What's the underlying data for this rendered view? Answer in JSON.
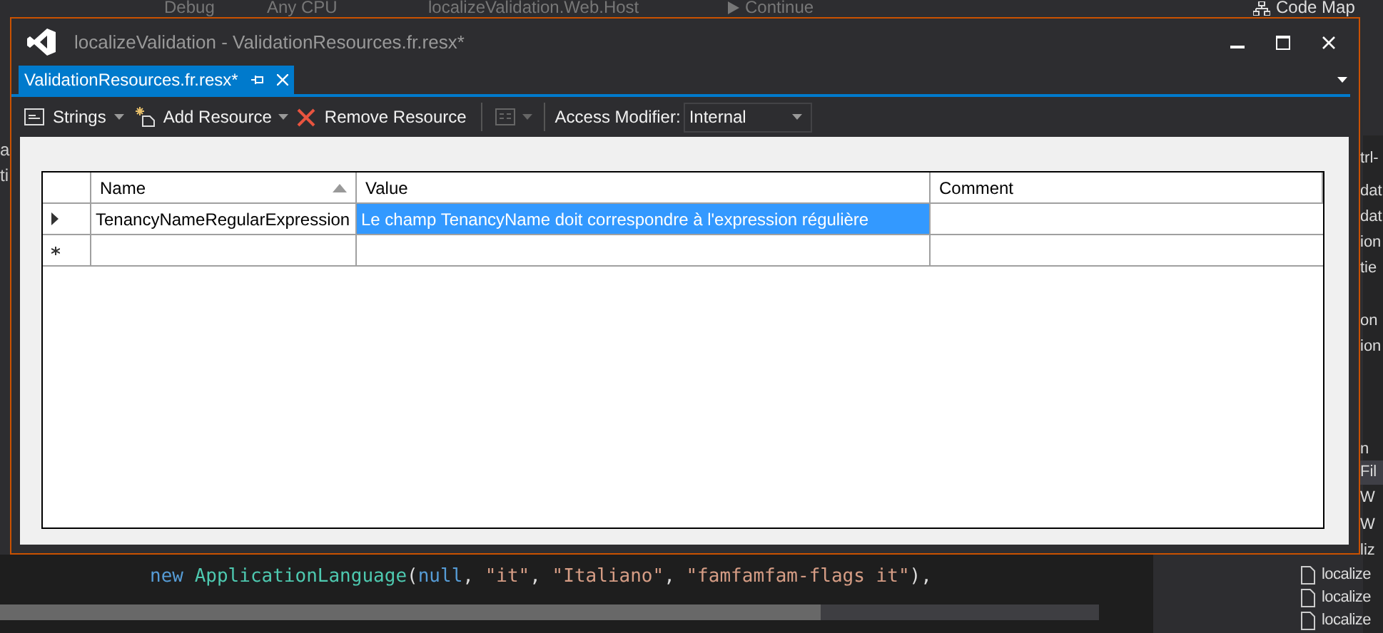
{
  "ide": {
    "toolbar": [
      {
        "text": "Debug",
        "kind": "combo"
      },
      {
        "text": "Any CPU",
        "kind": "combo"
      },
      {
        "text": "localizeValidation.Web.Host",
        "kind": "combo"
      },
      {
        "text": "Continue",
        "kind": "run"
      },
      {
        "text": "Code Map",
        "kind": "map"
      }
    ],
    "left_fragments": [
      "a",
      "ti"
    ],
    "right_fragments": [
      {
        "text": "trl-",
        "selected": false
      },
      {
        "text": "dat",
        "selected": false
      },
      {
        "text": "dat",
        "selected": false
      },
      {
        "text": "ion",
        "selected": false
      },
      {
        "text": "tie",
        "selected": false
      },
      {
        "text": "on",
        "selected": false
      },
      {
        "text": "ion",
        "selected": false
      },
      {
        "text": "n",
        "selected": false
      },
      {
        "text": "Fil",
        "selected": true
      },
      {
        "text": "W",
        "selected": false
      },
      {
        "text": "W",
        "selected": false
      },
      {
        "text": "liz",
        "selected": false
      }
    ],
    "solution_items": [
      "localize",
      "localize",
      "localize"
    ],
    "code_line": [
      {
        "text": "new ",
        "kind": "keyword"
      },
      {
        "text": "ApplicationLanguage",
        "kind": "type"
      },
      {
        "text": "(",
        "kind": "plain"
      },
      {
        "text": "null",
        "kind": "keyword"
      },
      {
        "text": ", ",
        "kind": "plain"
      },
      {
        "text": "\"it\"",
        "kind": "string"
      },
      {
        "text": ", ",
        "kind": "plain"
      },
      {
        "text": "\"Italiano\"",
        "kind": "string"
      },
      {
        "text": ", ",
        "kind": "plain"
      },
      {
        "text": "\"famfamfam-flags it\"",
        "kind": "string"
      },
      {
        "text": "),",
        "kind": "plain"
      }
    ]
  },
  "window": {
    "title": "localizeValidation - ValidationResources.fr.resx*"
  },
  "tab": {
    "label": "ValidationResources.fr.resx*",
    "selected": true
  },
  "toolbar": {
    "strings": "Strings",
    "add": "Add Resource",
    "remove": "Remove Resource",
    "access_label": "Access Modifier:",
    "access_value": "Internal"
  },
  "table": {
    "columns": [
      {
        "label": "Name",
        "sorted": true
      },
      {
        "label": "Value",
        "sorted": false
      },
      {
        "label": "Comment",
        "sorted": false
      }
    ],
    "rows": [
      {
        "kind": "data",
        "name": "TenancyNameRegularExpression",
        "value": "Le champ TenancyName doit correspondre à l'expression régulière",
        "value_selected": true
      },
      {
        "kind": "new"
      }
    ]
  }
}
